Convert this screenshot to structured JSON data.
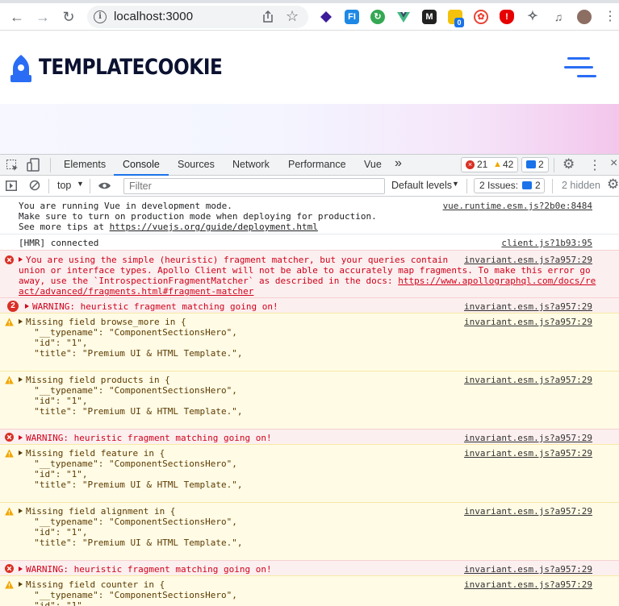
{
  "browser": {
    "url": "localhost:3000",
    "extensions": [
      "dark-reader-icon",
      "fi-icon",
      "refresh-ext-icon",
      "vue-devtools-icon",
      "m-icon",
      "notes-icon",
      "translate-icon",
      "adblock-icon",
      "puzzle-icon",
      "media-icon",
      "avatar"
    ],
    "notes_badge": "0"
  },
  "site": {
    "logo_text": "TEMPLATECOOKIE"
  },
  "devtools": {
    "tabs": [
      "Elements",
      "Console",
      "Sources",
      "Network",
      "Performance",
      "Vue"
    ],
    "more_tabs": "»",
    "errors_count": "21",
    "warnings_count": "42",
    "messages_count": "2",
    "context": "top",
    "filter_placeholder": "Filter",
    "levels": "Default levels",
    "issues_label": "2 Issues:",
    "issues_count": "2",
    "hidden_label": "2 hidden"
  },
  "console": {
    "vue_mode": {
      "line1": "You are running Vue in development mode.",
      "line2": "Make sure to turn on production mode when deploying for production.",
      "line3_prefix": "See more tips at ",
      "line3_link": "https://vuejs.org/guide/deployment.html",
      "source": "vue.runtime.esm.js?2b0e:8484"
    },
    "hmr": {
      "text": "[HMR] connected",
      "source": "client.js?1b93:95"
    },
    "apollo_error": {
      "line1": "You are using the simple (heuristic) fragment matcher, but your queries contain",
      "line2": "union or interface types. Apollo Client will not be able to accurately map fragments. To make this error go",
      "line3_prefix": "away, use the `IntrospectionFragmentMatcher` as described in the docs: ",
      "line3_link": "https://www.apollographql.com/docs/re",
      "line4_link": "act/advanced/fragments.html#fragment-matcher",
      "source": "invariant.esm.js?a957:29"
    },
    "warning_repeat_count": "2",
    "heuristic_warning": "WARNING: heuristic fragment matching going on!",
    "source": "invariant.esm.js?a957:29",
    "missing_fields": [
      {
        "title": "Missing field browse_more in {",
        "typename": "  \"__typename\": \"ComponentSectionsHero\",",
        "id": "  \"id\": \"1\",",
        "title_line": "  \"title\": \"Premium UI & HTML Template.\","
      },
      {
        "title": "Missing field products in {",
        "typename": "  \"__typename\": \"ComponentSectionsHero\",",
        "id": "  \"id\": \"1\",",
        "title_line": "  \"title\": \"Premium UI & HTML Template.\","
      },
      {
        "title": "Missing field feature in {",
        "typename": "  \"__typename\": \"ComponentSectionsHero\",",
        "id": "  \"id\": \"1\",",
        "title_line": "  \"title\": \"Premium UI & HTML Template.\","
      },
      {
        "title": "Missing field alignment in {",
        "typename": "  \"__typename\": \"ComponentSectionsHero\",",
        "id": "  \"id\": \"1\",",
        "title_line": "  \"title\": \"Premium UI & HTML Template.\","
      },
      {
        "title": "Missing field counter in {",
        "typename": "  \"__typename\": \"ComponentSectionsHero\",",
        "id": "  \"id\": \"1\","
      }
    ]
  },
  "colors": {
    "accent": "#1a73e8",
    "error": "#d0021b",
    "warning_icon": "#f2a600",
    "brand_dark": "#0b1130",
    "brand_blue": "#2a6df4"
  }
}
